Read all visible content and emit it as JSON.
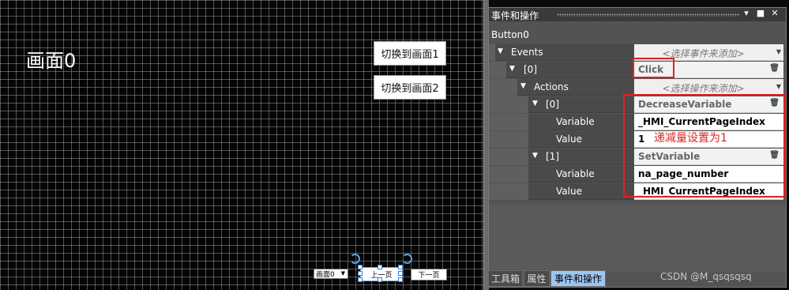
{
  "canvas": {
    "page_label": "画面0",
    "switch_button_1": "切换到画面1",
    "switch_button_2": "切换到画面2",
    "page_dropdown": "画面0",
    "prev_button": "上一页",
    "next_button": "下一页"
  },
  "panel": {
    "title": "事件和操作",
    "object_name": "Button0",
    "rows": [
      {
        "label": "Events",
        "value": "<选择事件来添加>"
      },
      {
        "label": "[0]",
        "value": "Click"
      },
      {
        "label": "Actions",
        "value": "<选择操作来添加>"
      },
      {
        "label": "[0]",
        "value": "DecreaseVariable"
      },
      {
        "label": "Variable",
        "value": "_HMI_CurrentPageIndex"
      },
      {
        "label": "Value",
        "value": "1"
      },
      {
        "label": "[1]",
        "value": "SetVariable"
      },
      {
        "label": "Variable",
        "value": "na_page_number"
      },
      {
        "label": "Value",
        "value": "_HMI_CurrentPageIndex"
      }
    ]
  },
  "annotation": {
    "note": "递减量设置为1",
    "color": "#e02020"
  },
  "tabs": [
    {
      "label": "工具箱",
      "active": false
    },
    {
      "label": "属性",
      "active": false
    },
    {
      "label": "事件和操作",
      "active": true
    }
  ],
  "watermark": "CSDN @M_qsqsqsq",
  "icons": [
    "pin-icon",
    "maximize-icon",
    "close-icon",
    "expand-triangle-icon",
    "delete-icon",
    "dropdown-arrow-icon"
  ]
}
